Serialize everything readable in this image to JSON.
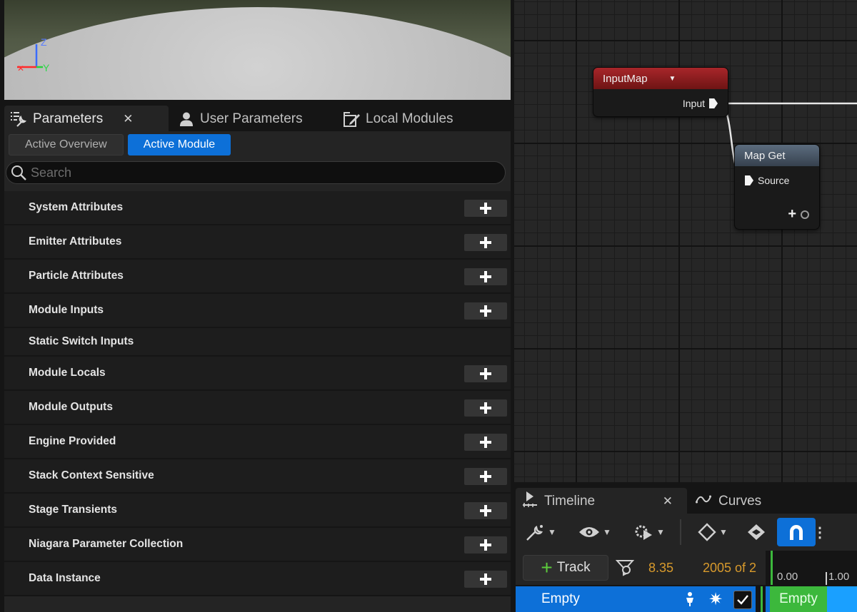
{
  "viewport": {
    "axis_labels": {
      "z": "Z",
      "y": "Y"
    }
  },
  "left_tabs": {
    "parameters": "Parameters",
    "user_parameters": "User Parameters",
    "local_modules": "Local Modules",
    "close_glyph": "✕"
  },
  "mode_buttons": {
    "overview": "Active Overview",
    "module": "Active Module"
  },
  "search": {
    "placeholder": "Search"
  },
  "categories": [
    {
      "label": "System Attributes",
      "has_add": true
    },
    {
      "label": "Emitter Attributes",
      "has_add": true
    },
    {
      "label": "Particle Attributes",
      "has_add": true
    },
    {
      "label": "Module Inputs",
      "has_add": true
    },
    {
      "label": "Static Switch Inputs",
      "has_add": false
    },
    {
      "label": "Module Locals",
      "has_add": true
    },
    {
      "label": "Module Outputs",
      "has_add": true
    },
    {
      "label": "Engine Provided",
      "has_add": true
    },
    {
      "label": "Stack Context Sensitive",
      "has_add": true
    },
    {
      "label": "Stage Transients",
      "has_add": true
    },
    {
      "label": "Niagara Parameter Collection",
      "has_add": true
    },
    {
      "label": "Data Instance",
      "has_add": true
    }
  ],
  "graph": {
    "input_map": {
      "title": "InputMap",
      "pin": "Input"
    },
    "map_get": {
      "title": "Map Get",
      "pin": "Source"
    }
  },
  "timeline": {
    "tab_timeline": "Timeline",
    "tab_curves": "Curves",
    "close_glyph": "✕",
    "track_label": "Track",
    "current_time": "8.35",
    "frame_text": "2005 of 2",
    "ruler": [
      "0.00",
      "1.00"
    ],
    "row_label": "Empty",
    "clip_label": "Empty"
  },
  "colors": {
    "accent_blue": "#0d70d8",
    "input_map_header": "#8c1c1c",
    "map_get_header": "#4a5868",
    "timeline_orange": "#d89a2c",
    "clip_green": "#3cb83c"
  }
}
